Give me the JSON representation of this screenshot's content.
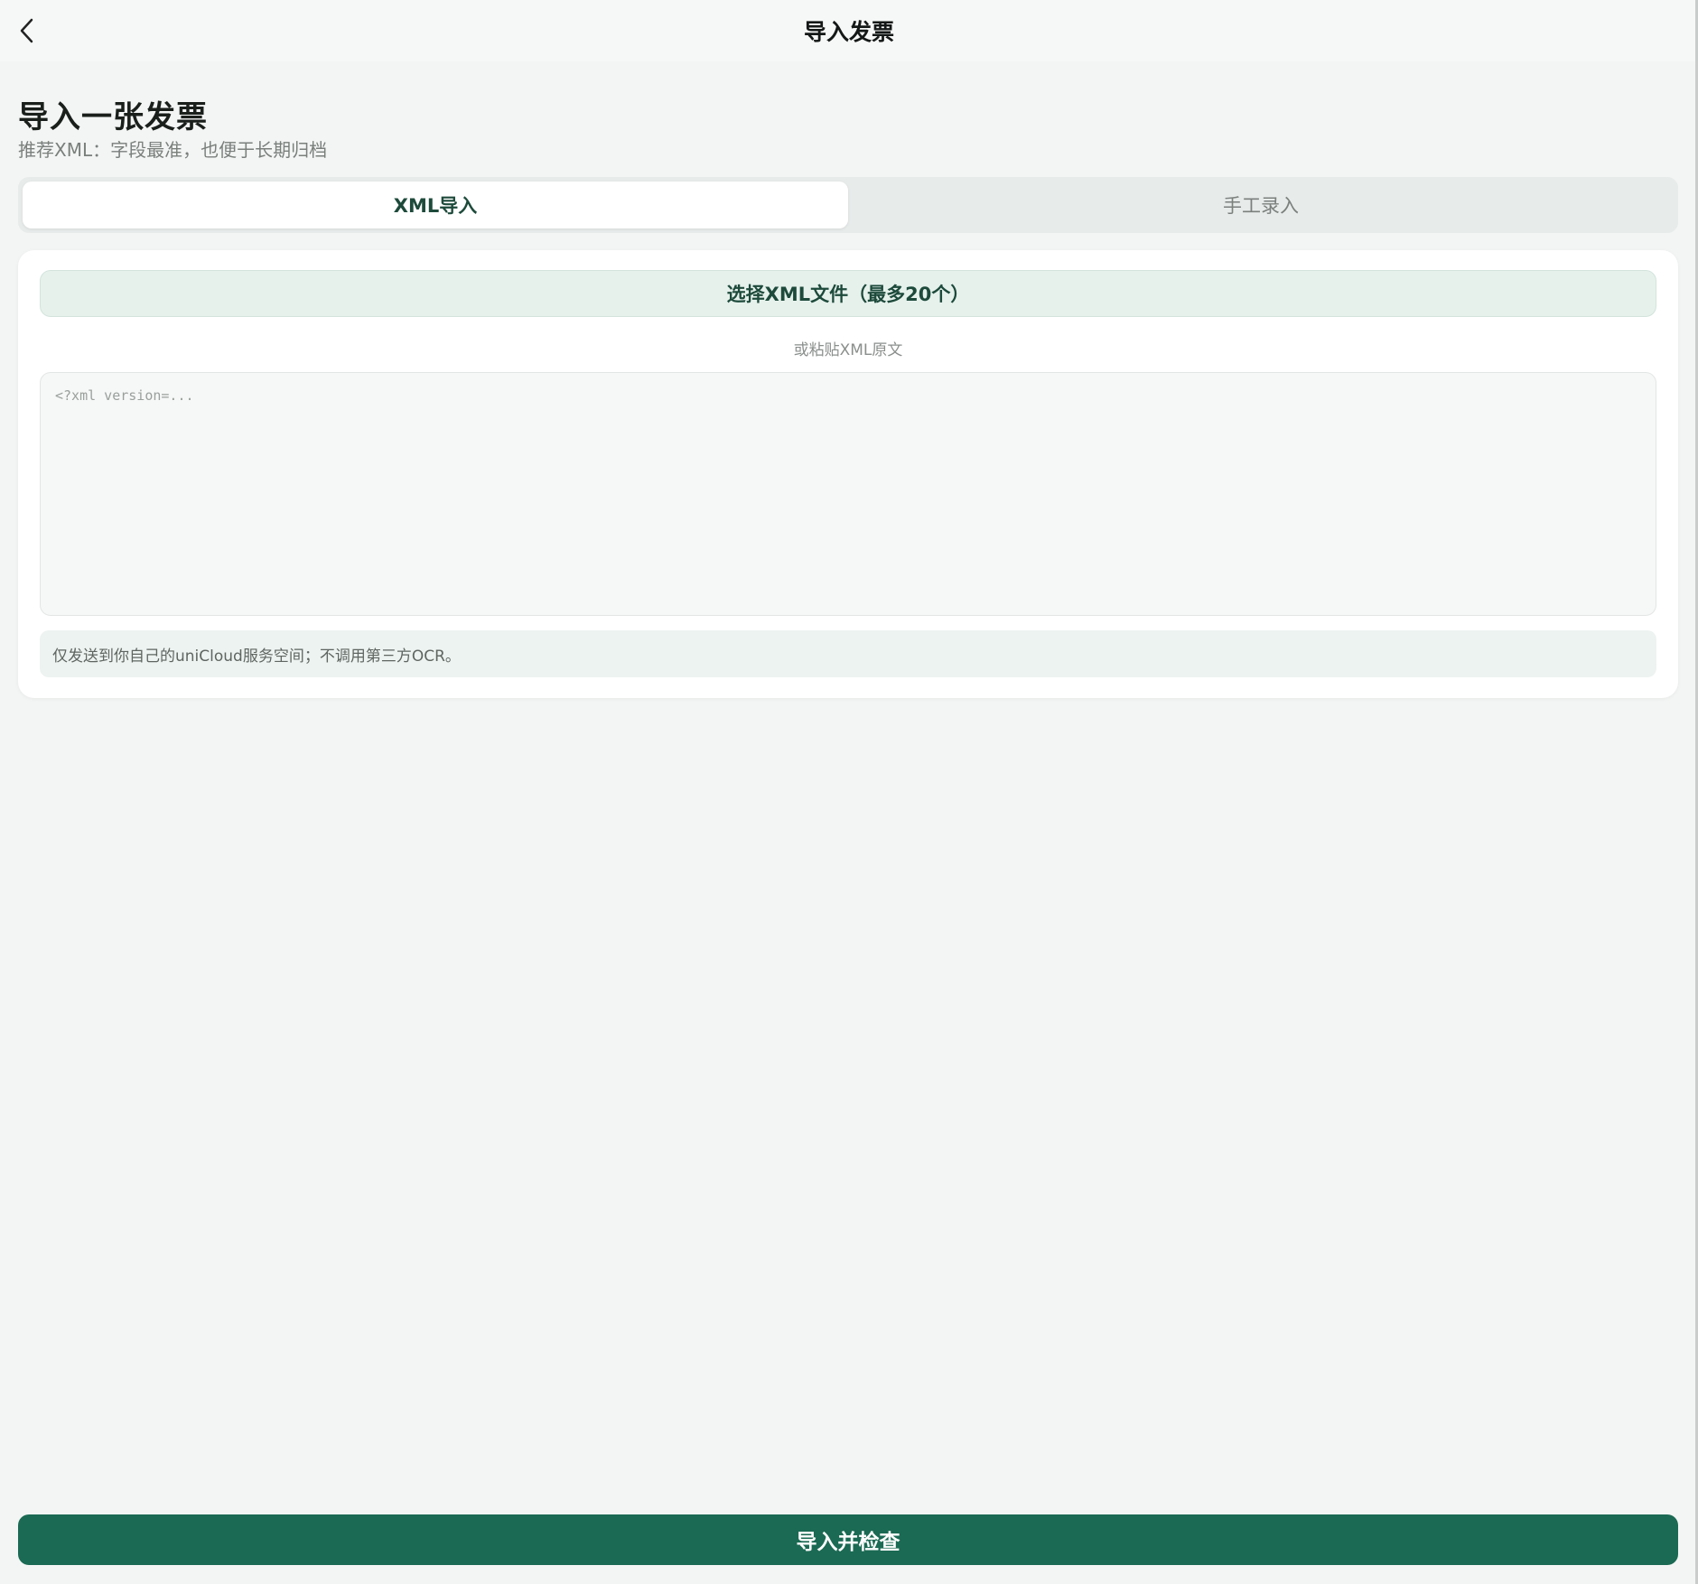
{
  "nav": {
    "title": "导入发票",
    "back_icon": "chevron-left-icon"
  },
  "header": {
    "title": "导入一张发票",
    "subtitle": "推荐XML：字段最准，也便于长期归档"
  },
  "tabs": [
    {
      "label": "XML导入",
      "active": true
    },
    {
      "label": "手工录入",
      "active": false
    }
  ],
  "card": {
    "select_button_label": "选择XML文件（最多20个）",
    "paste_hint": "或粘贴XML原文",
    "xml_placeholder": "<?xml version=...",
    "xml_value": "",
    "privacy_note": "仅发送到你自己的uniCloud服务空间；不调用第三方OCR。"
  },
  "footer": {
    "submit_label": "导入并检查"
  },
  "colors": {
    "accent": "#1b6a53",
    "accent_text": "#1d4a3b",
    "background": "#f3f5f4"
  }
}
